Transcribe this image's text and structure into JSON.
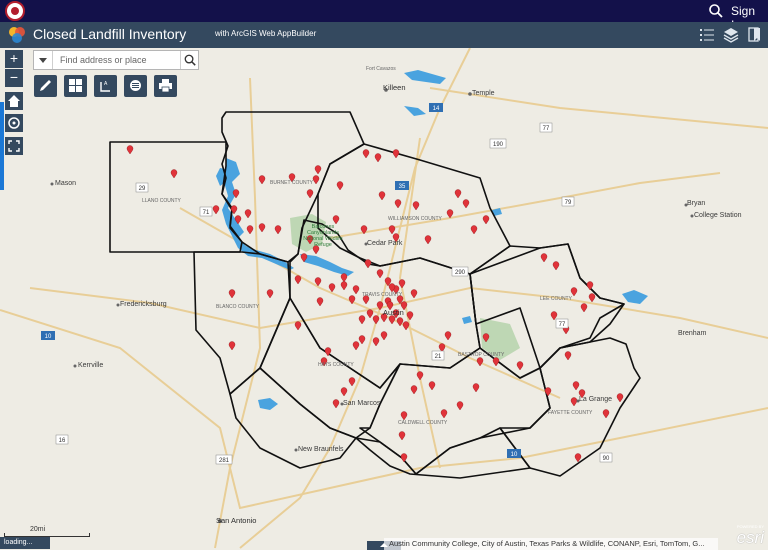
{
  "topbar": {
    "signin_label": "Sign In"
  },
  "header": {
    "title": "Closed Landfill Inventory",
    "subtitle": "with ArcGIS Web AppBuilder"
  },
  "search": {
    "placeholder": "Find address or place"
  },
  "zoom": {
    "in_label": "+",
    "out_label": "−"
  },
  "tools": [
    "draw-tool",
    "basemap-gallery-tool",
    "measurement-tool",
    "layer-list-tool",
    "print-tool"
  ],
  "places": {
    "fort_cavazos": "Fort Cavazos",
    "killeen": "Killeen",
    "temple": "Temple",
    "mason": "Mason",
    "bryan": "Bryan",
    "college_station": "College Station",
    "cedar_park": "Cedar Park",
    "fredericksburg": "Fredericksburg",
    "austin": "Austin",
    "brenham": "Brenham",
    "kerrville": "Kerrville",
    "la_grange": "La Grange",
    "san_marcos": "San Marcos",
    "new_braunfels": "New Braunfels",
    "san_antonio": "San Antonio",
    "balcones": "Balcones Canyonlands National Wildlife Refuge",
    "williamson_county": "WILLIAMSON COUNTY",
    "travis_county": "TRAVIS COUNTY",
    "burnet_county": "BURNET COUNTY",
    "blanco_county": "BLANCO COUNTY",
    "hays_county": "HAYS COUNTY",
    "bastrop_county": "BASTROP COUNTY",
    "lee_county": "LEE COUNTY",
    "fayette_county": "FAYETTE COUNTY",
    "caldwell_county": "CALDWELL COUNTY",
    "llano_county": "LLANO COUNTY"
  },
  "road_labels": [
    "14",
    "77",
    "190",
    "79",
    "29",
    "71",
    "35",
    "290",
    "21",
    "10",
    "281",
    "16",
    "90",
    "77",
    "10"
  ],
  "map_footer": {
    "attribution": "Austin Community College, City of Austin, Texas Parks & Wildlife, CONANP, Esri, TomTom, G...",
    "loading": "loading...",
    "scale": "20mi",
    "esri_powered": "POWERED BY",
    "esri_word": "esri"
  },
  "colors": {
    "topbar": "#13114a",
    "header": "#34495f",
    "marker": "#e0333a",
    "water": "#4aa3df",
    "boundary": "#111111"
  }
}
